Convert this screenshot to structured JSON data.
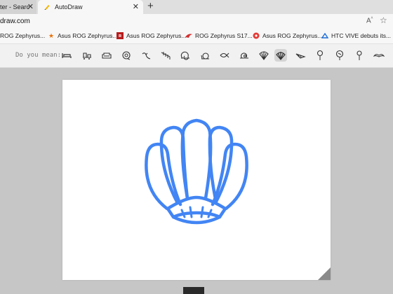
{
  "tabs": [
    {
      "label": "ter - Searc",
      "active": false
    },
    {
      "label": "AutoDraw",
      "active": true
    }
  ],
  "address": {
    "url": "draw.com"
  },
  "bookmarks": [
    {
      "label": "ROG Zephyrus...",
      "icon": "none"
    },
    {
      "label": "Asus ROG Zephyrus...",
      "icon": "star-icon"
    },
    {
      "label": "Asus ROG Zephyrus...",
      "icon": "rog-logo-icon"
    },
    {
      "label": "ROG Zephyrus S17...",
      "icon": "rog-eye-icon"
    },
    {
      "label": "Asus ROG Zephyrus...",
      "icon": "red-flower-icon"
    },
    {
      "label": "HTC VIVE debuts its...",
      "icon": "vive-icon"
    }
  ],
  "suggestions": {
    "label": "Do you mean:",
    "selected_index": 13,
    "items": [
      "bed-icon",
      "train-icon",
      "sofa-icon",
      "snail-icon",
      "bird-icon",
      "fish-skeleton-icon",
      "snail-shell-icon",
      "snail-icon",
      "fish-icon",
      "snail-slug-icon",
      "shell-icon",
      "shell-selected-icon",
      "seashell-icon",
      "lollipop-icon",
      "tree-icon",
      "lollipop-icon",
      "mustache-icon"
    ]
  },
  "colors": {
    "accent": "#4285f4"
  }
}
